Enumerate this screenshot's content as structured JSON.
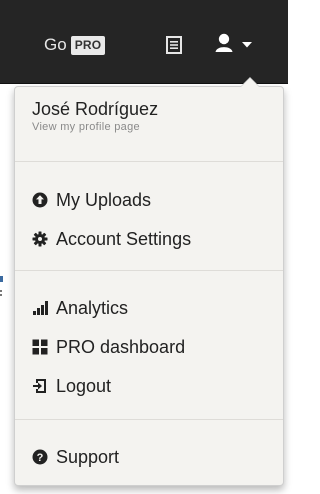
{
  "topbar": {
    "go_text": "Go",
    "pro_badge": "PRO"
  },
  "menu": {
    "profile": {
      "name": "José Rodríguez",
      "subtitle": "View my profile page"
    },
    "groups": [
      [
        {
          "label": "My Uploads",
          "icon": "upload-circle-icon"
        },
        {
          "label": "Account Settings",
          "icon": "gear-icon"
        }
      ],
      [
        {
          "label": "Analytics",
          "icon": "signal-bars-icon"
        },
        {
          "label": "PRO dashboard",
          "icon": "grid-icon"
        },
        {
          "label": "Logout",
          "icon": "logout-icon"
        }
      ],
      [
        {
          "label": "Support",
          "icon": "question-circle-icon"
        }
      ]
    ]
  },
  "colors": {
    "topbar_bg": "#252525",
    "menu_bg": "#f4f3f0",
    "text": "#222222",
    "muted": "#8a8a8a"
  }
}
